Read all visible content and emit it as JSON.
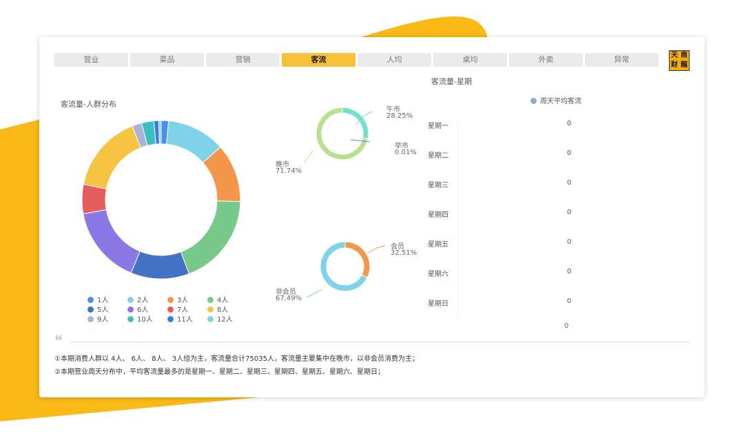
{
  "tabs": [
    {
      "label": "营业"
    },
    {
      "label": "菜品"
    },
    {
      "label": "营销"
    },
    {
      "label": "客流",
      "active": true
    },
    {
      "label": "人均"
    },
    {
      "label": "桌均"
    },
    {
      "label": "外卖"
    },
    {
      "label": "异常"
    }
  ],
  "logo": {
    "chars": [
      "天",
      "商",
      "财",
      "龍"
    ]
  },
  "colors": {
    "accent": "#f7c23a",
    "background_shape": "#f9b916"
  },
  "crowd_chart": {
    "title": "客流量-人群分布",
    "chart_data": {
      "type": "pie",
      "categories": [
        "1人",
        "2人",
        "3人",
        "4人",
        "5人",
        "6人",
        "7人",
        "8人",
        "9人",
        "10人",
        "11人",
        "12人"
      ],
      "values": [
        1.5,
        12,
        12,
        19,
        12,
        16,
        6,
        16,
        2,
        2.5,
        1,
        0.5
      ],
      "colors": [
        "#4a8fe7",
        "#7fd3e8",
        "#f4974a",
        "#78c98a",
        "#4472c4",
        "#8b78e6",
        "#e55e5e",
        "#f6c343",
        "#a7b5d4",
        "#3dbfbf",
        "#3a7de0",
        "#86cde8"
      ],
      "legend_position": "bottom"
    }
  },
  "time_chart": {
    "chart_data": {
      "type": "pie",
      "slices": [
        {
          "name": "午市",
          "percent": "28.25%",
          "value": 28.25,
          "color": "#6fe3c8"
        },
        {
          "name": "早市",
          "percent": "0.01%",
          "value": 0.01,
          "color": "#4a8fe7"
        },
        {
          "name": "晚市",
          "percent": "71.74%",
          "value": 71.74,
          "color": "#b8e08e"
        }
      ]
    }
  },
  "member_chart": {
    "chart_data": {
      "type": "pie",
      "slices": [
        {
          "name": "会员",
          "percent": "32.51%",
          "value": 32.51,
          "color": "#f4974a"
        },
        {
          "name": "非会员",
          "percent": "67.49%",
          "value": 67.49,
          "color": "#7fd3e8"
        }
      ]
    }
  },
  "weekday_chart": {
    "title": "客流量-星期",
    "legend": "周天平均客流",
    "legend_color": "#8fa9d6",
    "chart_data": {
      "type": "bar",
      "categories": [
        "星期一",
        "星期二",
        "星期三",
        "星期四",
        "星期五",
        "星期六",
        "星期日"
      ],
      "values": [
        0,
        0,
        0,
        0,
        0,
        0,
        0
      ],
      "axis_label": "0"
    }
  },
  "summary": {
    "line1": "①本期消费人群以 4人、 6人、 8人、 3人组为主，客流量合计75035人，客流量主要集中在晚市，以非会员消费为主；",
    "line2": "②本期营业周天分布中，平均客流量最多的是星期一、星期二、星期三、星期四、星期五、星期六、星期日；"
  }
}
